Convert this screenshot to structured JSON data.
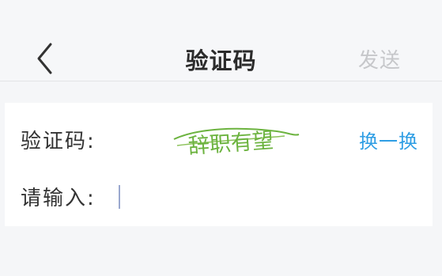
{
  "nav": {
    "back_icon": "chevron-left-icon",
    "title": "验证码",
    "send_label": "发送"
  },
  "form": {
    "captcha_label": "验证码:",
    "captcha_text": "辞职有望",
    "refresh_label": "换一换",
    "input_label": "请输入:",
    "input_value": "",
    "input_placeholder": ""
  },
  "colors": {
    "accent": "#2f9ee4",
    "captcha_green": "#6cb33f",
    "disabled_text": "#c6c7ca"
  }
}
